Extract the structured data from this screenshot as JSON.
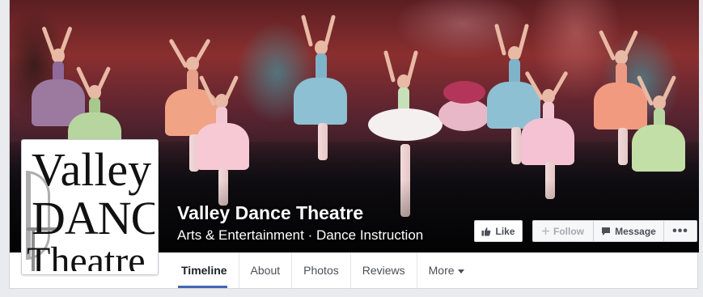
{
  "page": {
    "name": "Valley Dance Theatre",
    "categories": "Arts & Entertainment · Dance Instruction"
  },
  "logo": {
    "line1": "Valley",
    "line2": "DANCE",
    "line3": "Theatre"
  },
  "actions": {
    "like_label": "Like",
    "follow_label": "Follow",
    "message_label": "Message",
    "more_label": "•••"
  },
  "tabs": [
    {
      "label": "Timeline",
      "active": true
    },
    {
      "label": "About"
    },
    {
      "label": "Photos"
    },
    {
      "label": "Reviews"
    },
    {
      "label": "More"
    }
  ],
  "colors": {
    "accent": "#4267b2",
    "follow_disabled": "#a6a9ae"
  },
  "icons": {
    "like": "thumbs-up-icon",
    "follow": "plus-icon",
    "message": "speech-bubble-icon",
    "more": "ellipsis-icon",
    "tab_more": "caret-down-icon"
  }
}
